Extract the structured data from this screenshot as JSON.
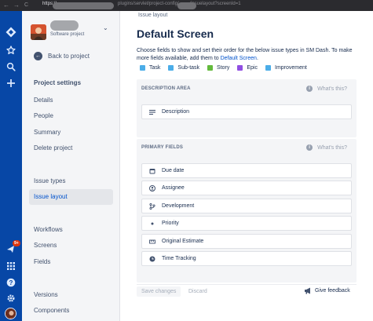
{
  "browser": {
    "nav_back": "←",
    "nav_forward": "→",
    "nav_reload": "C",
    "url_scheme": "https://",
    "url_path": "plugins/servlet/project-config/",
    "url_tail": "/issuelayout?screenId=1"
  },
  "project": {
    "type_label": "Software project"
  },
  "sidebar": {
    "back_label": "Back to project",
    "section_title": "Project settings",
    "items": [
      {
        "label": "Details"
      },
      {
        "label": "People"
      },
      {
        "label": "Summary"
      },
      {
        "label": "Delete project"
      },
      {
        "label": "Issue types"
      },
      {
        "label": "Issue layout",
        "active": true
      },
      {
        "label": "Workflows"
      },
      {
        "label": "Screens"
      },
      {
        "label": "Fields"
      },
      {
        "label": "Versions"
      },
      {
        "label": "Components"
      }
    ]
  },
  "global_nav": {
    "notification_count": "9+",
    "icons": [
      "jira-logo-icon",
      "star-icon",
      "search-icon",
      "create-icon",
      "notifications-icon",
      "apps-icon",
      "help-icon",
      "settings-icon",
      "user-avatar"
    ]
  },
  "page": {
    "breadcrumb": "Issue layout",
    "title": "Default Screen",
    "intro_text": "Choose fields to show and set their order for the below issue types in SM Dash. To make more fields available, add them to ",
    "intro_link": "Default Screen",
    "intro_end": "."
  },
  "issue_types": [
    {
      "label": "Task",
      "color": "#4bade8"
    },
    {
      "label": "Sub-task",
      "color": "#4bade8"
    },
    {
      "label": "Story",
      "color": "#63ba3c"
    },
    {
      "label": "Epic",
      "color": "#904ee2"
    },
    {
      "label": "Improvement",
      "color": "#4bade8"
    }
  ],
  "description_area": {
    "heading": "DESCRIPTION AREA",
    "help_label": "What's this?",
    "fields": [
      {
        "label": "Description",
        "icon": "text-lines-icon"
      }
    ]
  },
  "primary_fields": {
    "heading": "PRIMARY FIELDS",
    "help_label": "What's this?",
    "fields": [
      {
        "label": "Due date",
        "icon": "calendar-icon"
      },
      {
        "label": "Assignee",
        "icon": "user-circle-icon"
      },
      {
        "label": "Development",
        "icon": "branch-icon"
      },
      {
        "label": "Priority",
        "icon": "dot-icon"
      },
      {
        "label": "Original Estimate",
        "icon": "ruler-icon"
      },
      {
        "label": "Time Tracking",
        "icon": "clock-icon"
      }
    ]
  },
  "footer": {
    "save_label": "Save changes",
    "discard_label": "Discard",
    "feedback_label": "Give feedback"
  }
}
